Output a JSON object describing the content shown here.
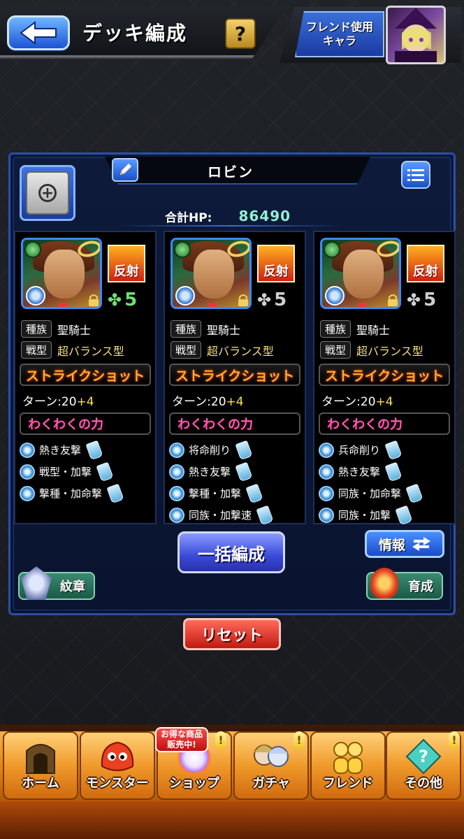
{
  "header": {
    "title": "デッキ編成",
    "help_label": "?",
    "friend_button": [
      "フレンド使用",
      "キャラ"
    ]
  },
  "deck": {
    "name": "ロビン",
    "total_hp_label": "合計HP:",
    "total_hp_value": "86490"
  },
  "cards": [
    {
      "ability": "反射",
      "luck": "5",
      "luck_style": "green",
      "race_label": "種族",
      "race": "聖騎士",
      "type_label": "戦型",
      "type": "超バランス型",
      "strike_shot": "ストライクショット",
      "turn_label": "ターン:20",
      "turn_plus": "+4",
      "skill": "わくわくの力",
      "abilities": [
        "熱き友撃",
        "戦型・加撃",
        "撃種・加命撃"
      ]
    },
    {
      "ability": "反射",
      "luck": "5",
      "luck_style": "gray",
      "race_label": "種族",
      "race": "聖騎士",
      "type_label": "戦型",
      "type": "超バランス型",
      "strike_shot": "ストライクショット",
      "turn_label": "ターン:20",
      "turn_plus": "+4",
      "skill": "わくわくの力",
      "abilities": [
        "将命削り",
        "熱き友撃",
        "撃種・加撃",
        "同族・加撃速"
      ]
    },
    {
      "ability": "反射",
      "luck": "5",
      "luck_style": "gray",
      "race_label": "種族",
      "race": "聖騎士",
      "type_label": "戦型",
      "type": "超バランス型",
      "strike_shot": "ストライクショット",
      "turn_label": "ターン:20",
      "turn_plus": "+4",
      "skill": "わくわくの力",
      "abilities": [
        "兵命削り",
        "熱き友撃",
        "同族・加命撃",
        "同族・加撃"
      ]
    }
  ],
  "buttons": {
    "bulk": "一括編成",
    "info": "情報",
    "emblem": "紋章",
    "train": "育成",
    "reset": "リセット"
  },
  "nav": {
    "promo": [
      "お得な商品",
      "販売中!"
    ],
    "items": [
      "ホーム",
      "モンスター",
      "ショップ",
      "ガチャ",
      "フレンド",
      "その他"
    ]
  }
}
